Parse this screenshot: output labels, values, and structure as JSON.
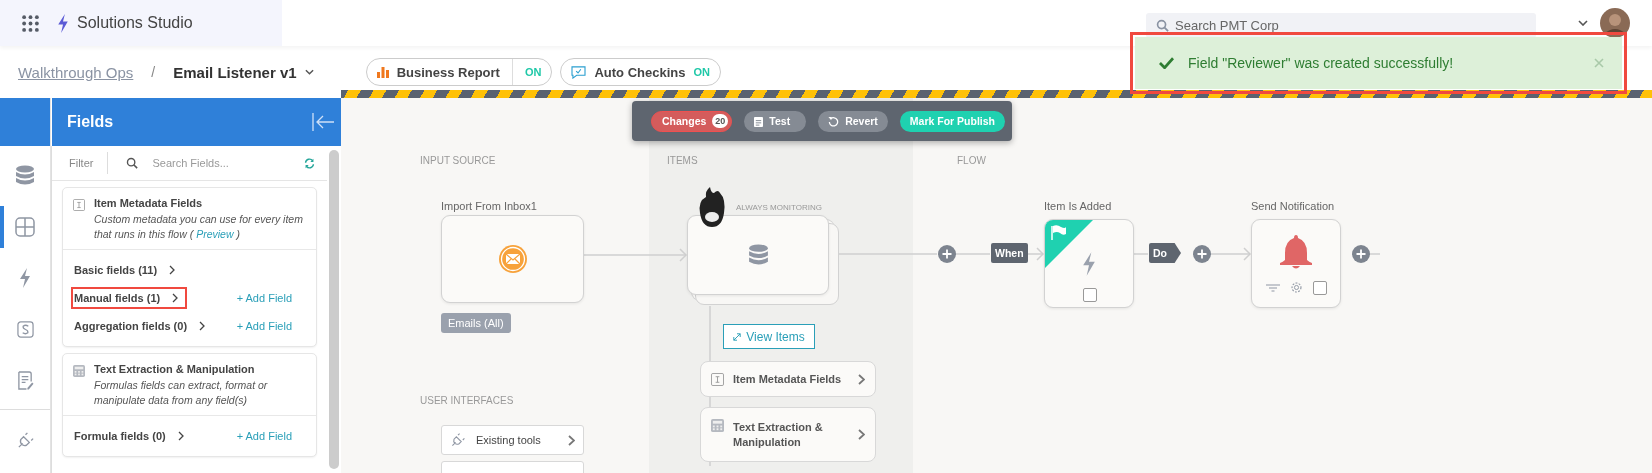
{
  "app": {
    "title": "Solutions Studio"
  },
  "search": {
    "placeholder": "Search PMT Corp"
  },
  "breadcrumb": {
    "parent": "Walkthrough Ops",
    "separator": "/",
    "current": "Email Listener v1"
  },
  "toggles": [
    {
      "kind": "report",
      "label": "Business Report",
      "state": "ON",
      "on": true
    },
    {
      "kind": "checkin",
      "label": "Auto Checkins",
      "state": "ON",
      "on": true
    }
  ],
  "toast": {
    "message": "Field \"Reviewer\" was created successfully!",
    "highlighted": true
  },
  "rail": [
    {
      "kind": "database",
      "selected": false
    },
    {
      "kind": "grid",
      "selected": true
    },
    {
      "kind": "bolt",
      "selected": false
    },
    {
      "kind": "script",
      "selected": false
    },
    {
      "kind": "document",
      "selected": false
    },
    {
      "kind": "plug",
      "selected": false
    }
  ],
  "fields_panel": {
    "title": "Fields",
    "filter_label": "Filter",
    "search_placeholder": "Search Fields...",
    "groups": [
      {
        "kind": "metadata",
        "title": "Item Metadata Fields",
        "description": "Custom metadata you can use for every item that runs in this flow ( ",
        "link": "Preview",
        "description_end": " )",
        "rows": [
          {
            "label": "Basic fields (11)",
            "highlighted": false
          },
          {
            "label": "Manual fields (1)",
            "highlighted": true,
            "action": "+ Add Field"
          },
          {
            "label": "Aggregation fields (0)",
            "highlighted": false,
            "action": "+ Add Field"
          }
        ]
      },
      {
        "kind": "formula",
        "title": "Text Extraction & Manipulation",
        "description": "Formulas fields can extract, format or manipulate data from any field(s)",
        "rows": [
          {
            "label": "Formula fields (0)",
            "highlighted": false,
            "action": "+ Add Field"
          }
        ]
      }
    ]
  },
  "toolbar": [
    {
      "kind": "changes",
      "label": "Changes",
      "count": "20"
    },
    {
      "kind": "test",
      "label": "Test"
    },
    {
      "kind": "revert",
      "label": "Revert"
    },
    {
      "kind": "publish",
      "label": "Mark For Publish"
    }
  ],
  "canvas": {
    "sections": [
      {
        "kind": "input",
        "label": "INPUT SOURCE"
      },
      {
        "kind": "items",
        "label": "ITEMS"
      },
      {
        "kind": "flow",
        "label": "FLOW"
      },
      {
        "kind": "ui",
        "label": "USER INTERFACES"
      }
    ],
    "input_node": {
      "title": "Import From Inbox1",
      "tag": "Emails (All)"
    },
    "items_node": {
      "status": "ALWAYS MONITORING",
      "button": "View Items",
      "cards": [
        {
          "kind": "metadata",
          "label": "Item Metadata Fields"
        },
        {
          "kind": "formula",
          "label": "Text Extraction & Manipulation"
        }
      ]
    },
    "flow": {
      "when": "When",
      "do": "Do",
      "trigger": {
        "title": "Item Is Added",
        "checked": false
      },
      "action": {
        "title": "Send Notification",
        "checked": false
      }
    },
    "user_interfaces": [
      {
        "label": "Existing tools"
      }
    ]
  }
}
